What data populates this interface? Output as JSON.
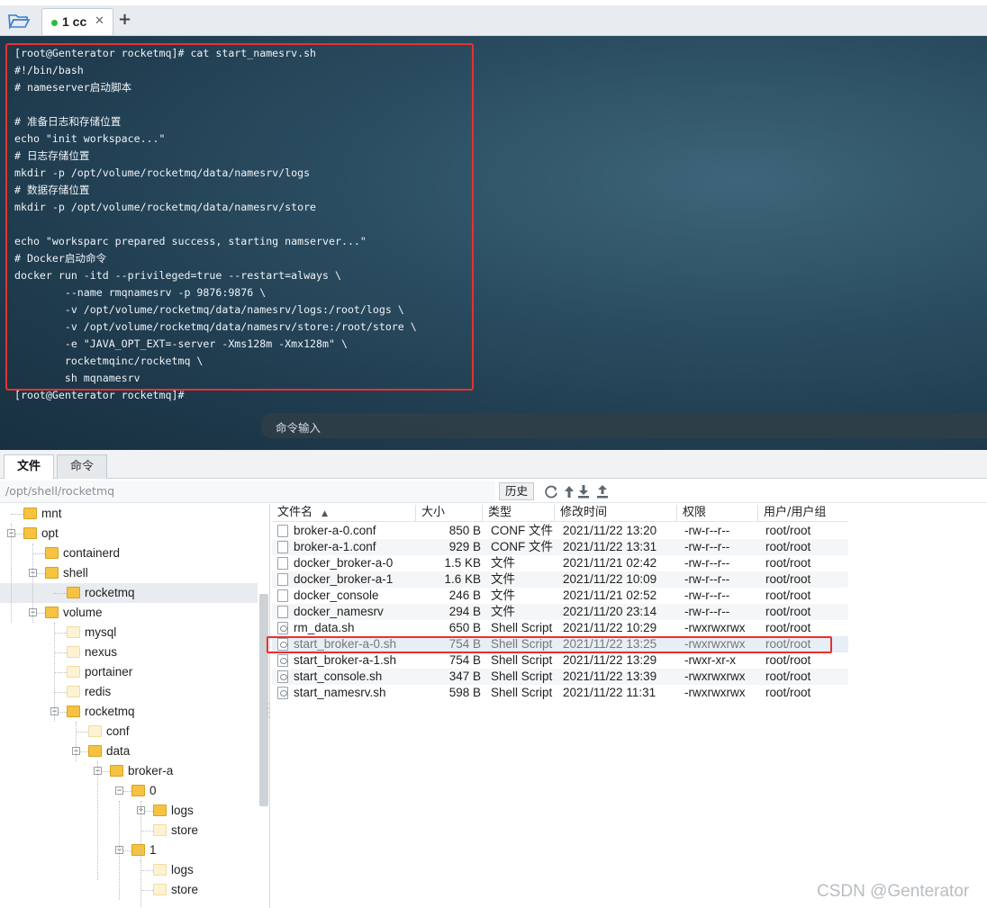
{
  "session_tabs": [
    {
      "label": "1 cc",
      "status_color": "#2dbb3a"
    }
  ],
  "icons": {
    "open_folder": "folder-open-icon",
    "add_tab": "plus-icon",
    "close_tab": "close-icon"
  },
  "add_tab_symbol": "+",
  "close_symbol": "✕",
  "terminal": {
    "lines": [
      "[root@Genterator rocketmq]# cat start_namesrv.sh",
      "#!/bin/bash",
      "# nameserver启动脚本",
      "",
      "# 准备日志和存储位置",
      "echo \"init workspace...\"",
      "# 日志存储位置",
      "mkdir -p /opt/volume/rocketmq/data/namesrv/logs",
      "# 数据存储位置",
      "mkdir -p /opt/volume/rocketmq/data/namesrv/store",
      "",
      "echo \"worksparc prepared success, starting namserver...\"",
      "# Docker启动命令",
      "docker run -itd --privileged=true --restart=always \\",
      "        --name rmqnamesrv -p 9876:9876 \\",
      "        -v /opt/volume/rocketmq/data/namesrv/logs:/root/logs \\",
      "        -v /opt/volume/rocketmq/data/namesrv/store:/root/store \\",
      "        -e \"JAVA_OPT_EXT=-server -Xms128m -Xmx128m\" \\",
      "        rocketmqinc/rocketmq \\",
      "        sh mqnamesrv",
      "[root@Genterator rocketmq]#"
    ],
    "command_input_placeholder": "命令输入",
    "grip": "....."
  },
  "lower_tabs": [
    "文件",
    "命令"
  ],
  "pathbar": {
    "path": "/opt/shell/rocketmq",
    "history_label": "历史",
    "tool_icons": [
      "refresh-icon",
      "up-directory-icon",
      "download-icon",
      "upload-icon"
    ]
  },
  "tree": [
    {
      "name": "mnt",
      "level": 1,
      "expander": "none"
    },
    {
      "name": "opt",
      "level": 1,
      "expander": "minus"
    },
    {
      "name": "containerd",
      "level": 2,
      "expander": "none"
    },
    {
      "name": "shell",
      "level": 2,
      "expander": "minus"
    },
    {
      "name": "rocketmq",
      "level": 3,
      "expander": "none",
      "selected": true
    },
    {
      "name": "volume",
      "level": 2,
      "expander": "minus"
    },
    {
      "name": "mysql",
      "level": 3,
      "expander": "none"
    },
    {
      "name": "nexus",
      "level": 3,
      "expander": "none"
    },
    {
      "name": "portainer",
      "level": 3,
      "expander": "none"
    },
    {
      "name": "redis",
      "level": 3,
      "expander": "none"
    },
    {
      "name": "rocketmq",
      "level": 3,
      "expander": "minus"
    },
    {
      "name": "conf",
      "level": 4,
      "expander": "none"
    },
    {
      "name": "data",
      "level": 4,
      "expander": "minus"
    },
    {
      "name": "broker-a",
      "level": 5,
      "expander": "minus"
    },
    {
      "name": "0",
      "level": 6,
      "expander": "minus"
    },
    {
      "name": "logs",
      "level": 7,
      "expander": "plus"
    },
    {
      "name": "store",
      "level": 7,
      "expander": "none"
    },
    {
      "name": "1",
      "level": 6,
      "expander": "minus"
    },
    {
      "name": "logs",
      "level": 7,
      "expander": "none"
    },
    {
      "name": "store",
      "level": 7,
      "expander": "none"
    }
  ],
  "file_columns": [
    "文件名",
    "大小",
    "类型",
    "修改时间",
    "权限",
    "用户/用户组"
  ],
  "sort_indicator": "▲",
  "files": [
    {
      "name": "broker-a-0.conf",
      "size": "850 B",
      "type": "CONF 文件",
      "modified": "2021/11/22 13:20",
      "perm": "-rw-r--r--",
      "owner": "root/root",
      "icon": "file-icon"
    },
    {
      "name": "broker-a-1.conf",
      "size": "929 B",
      "type": "CONF 文件",
      "modified": "2021/11/22 13:31",
      "perm": "-rw-r--r--",
      "owner": "root/root",
      "icon": "file-icon"
    },
    {
      "name": "docker_broker-a-0",
      "size": "1.5 KB",
      "type": "文件",
      "modified": "2021/11/21 02:42",
      "perm": "-rw-r--r--",
      "owner": "root/root",
      "icon": "file-icon"
    },
    {
      "name": "docker_broker-a-1",
      "size": "1.6 KB",
      "type": "文件",
      "modified": "2021/11/22 10:09",
      "perm": "-rw-r--r--",
      "owner": "root/root",
      "icon": "file-icon"
    },
    {
      "name": "docker_console",
      "size": "246 B",
      "type": "文件",
      "modified": "2021/11/21 02:52",
      "perm": "-rw-r--r--",
      "owner": "root/root",
      "icon": "file-icon"
    },
    {
      "name": "docker_namesrv",
      "size": "294 B",
      "type": "文件",
      "modified": "2021/11/20 23:14",
      "perm": "-rw-r--r--",
      "owner": "root/root",
      "icon": "file-icon"
    },
    {
      "name": "rm_data.sh",
      "size": "650 B",
      "type": "Shell Script",
      "modified": "2021/11/22 10:29",
      "perm": "-rwxrwxrwx",
      "owner": "root/root",
      "icon": "shell-script-icon"
    },
    {
      "name": "start_broker-a-0.sh",
      "size": "754 B",
      "type": "Shell Script",
      "modified": "2021/11/22 13:25",
      "perm": "-rwxrwxrwx",
      "owner": "root/root",
      "icon": "shell-script-icon",
      "selected": true
    },
    {
      "name": "start_broker-a-1.sh",
      "size": "754 B",
      "type": "Shell Script",
      "modified": "2021/11/22 13:29",
      "perm": "-rwxr-xr-x",
      "owner": "root/root",
      "icon": "shell-script-icon"
    },
    {
      "name": "start_console.sh",
      "size": "347 B",
      "type": "Shell Script",
      "modified": "2021/11/22 13:39",
      "perm": "-rwxrwxrwx",
      "owner": "root/root",
      "icon": "shell-script-icon"
    },
    {
      "name": "start_namesrv.sh",
      "size": "598 B",
      "type": "Shell Script",
      "modified": "2021/11/22 11:31",
      "perm": "-rwxrwxrwx",
      "owner": "root/root",
      "icon": "shell-script-icon"
    }
  ],
  "colors": {
    "highlight": "#e8312e",
    "terminal_bg": "#2b4d61",
    "folder": "#f5c242"
  },
  "watermark": "CSDN @Genterator"
}
